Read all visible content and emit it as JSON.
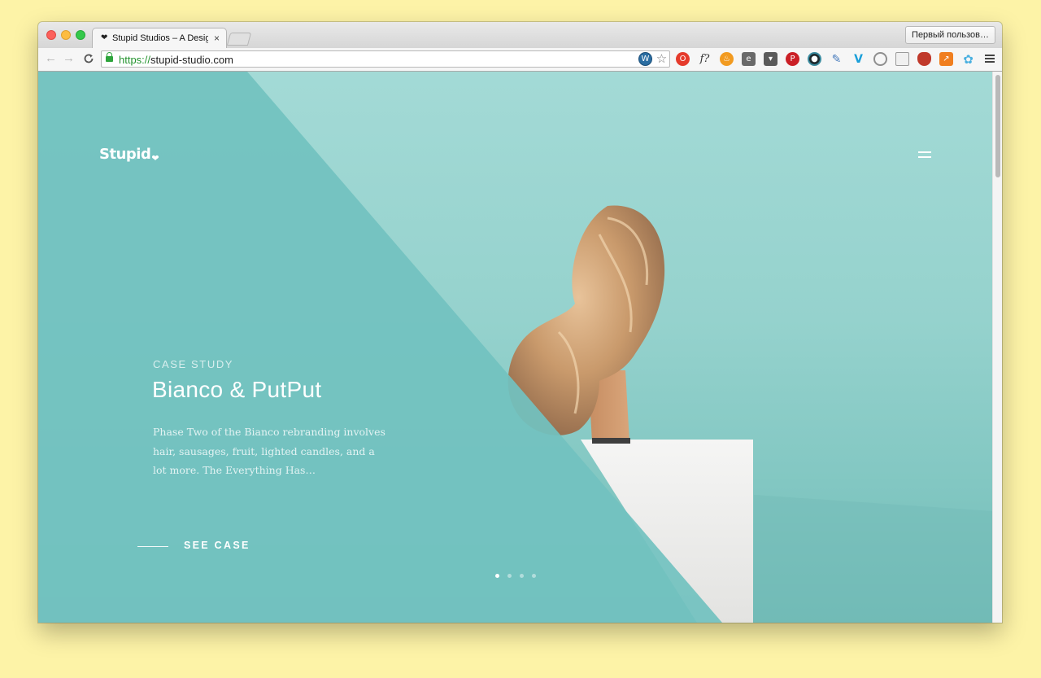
{
  "browser": {
    "tab_title": "Stupid Studios – A Design",
    "tab_favicon": "❤",
    "tab_close": "×",
    "profile_button": "Первый пользов…",
    "url_scheme": "https://",
    "url_host": "stupid-studio.com",
    "nav": {
      "back": "←",
      "forward": "→",
      "reload": "C"
    }
  },
  "extensions": [
    "wordpress-icon",
    "bookmark-star-icon",
    "opera-icon",
    "font-detect-icon",
    "fire-icon",
    "evernote-icon",
    "pocket-icon",
    "pinterest-icon",
    "eye-icon",
    "eyedropper-icon",
    "vimeo-icon",
    "refresh-circle-icon",
    "panels-icon",
    "hat-icon",
    "chart-icon",
    "flower-icon"
  ],
  "site": {
    "logo": "Stupid",
    "logo_heart": "❤",
    "eyebrow": "CASE STUDY",
    "headline": "Bianco & PutPut",
    "blurb": "Phase Two of the Bianco rebranding involves hair, sausages, fruit, lighted candles, and a lot more. The Everything Has…",
    "cta": "SEE CASE",
    "slides": {
      "total": 4,
      "active": 1
    }
  },
  "colors": {
    "background": "#fdf3a7",
    "page_teal": "#9dd7d3",
    "overlay_teal": "#74c3bf",
    "url_green": "#23932e"
  }
}
